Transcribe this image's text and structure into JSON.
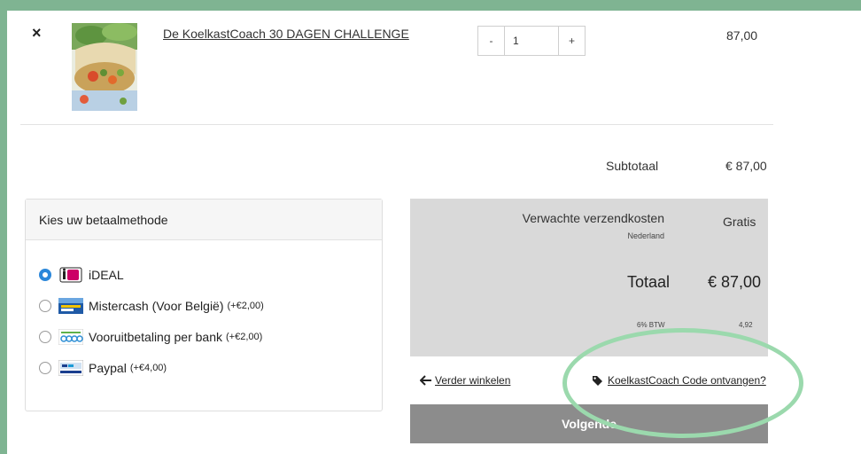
{
  "cart": {
    "item": {
      "title": "De KoelkastCoach 30 DAGEN CHALLENGE",
      "remove_glyph": "×",
      "qty_minus": "-",
      "qty_value": "1",
      "qty_plus": "+",
      "price": "87,00"
    },
    "subtotal_label": "Subtotaal",
    "subtotal_value": "€ 87,00"
  },
  "payment": {
    "heading": "Kies uw betaalmethode",
    "options": [
      {
        "label": "iDEAL",
        "extra": "",
        "icon": "ideal-logo-icon",
        "selected": true
      },
      {
        "label": "Mistercash (Voor België)",
        "extra": "(+€2,00)",
        "icon": "mistercash-logo-icon",
        "selected": false
      },
      {
        "label": "Vooruitbetaling per bank",
        "extra": "(+€2,00)",
        "icon": "bank-transfer-logo-icon",
        "selected": false
      },
      {
        "label": "Paypal",
        "extra": "(+€4,00)",
        "icon": "paypal-logo-icon",
        "selected": false
      }
    ]
  },
  "summary": {
    "shipping_label": "Verwachte verzendkosten",
    "shipping_country": "Nederland",
    "shipping_value": "Gratis",
    "total_label": "Totaal",
    "total_value": "€ 87,00",
    "tax_label": "6% BTW",
    "tax_value": "4,92"
  },
  "actions": {
    "back_label": "Verder winkelen",
    "code_label": "KoelkastCoach Code ontvangen?",
    "next_label": "Volgende"
  },
  "colors": {
    "background": "#7fb492",
    "radio_selected": "#2b87da",
    "highlight_ring": "#9bd9ad",
    "next_button": "#8c8c8c"
  }
}
